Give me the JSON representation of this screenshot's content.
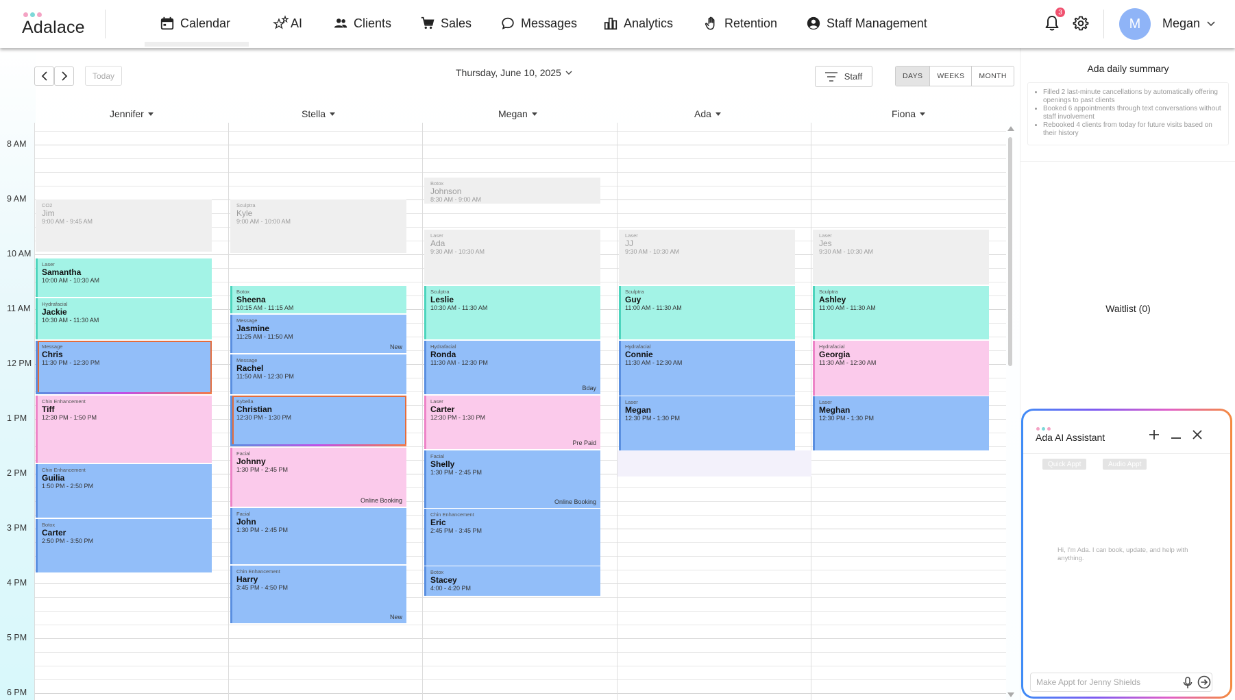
{
  "app": {
    "logo_text": "Adalace",
    "logo_dot_colors": [
      "#f4a3c4",
      "#7dd8d8",
      "#f4a3c4"
    ]
  },
  "nav": {
    "items": [
      {
        "label": "Calendar",
        "icon": "calendar-icon",
        "active": true
      },
      {
        "label": "AI",
        "icon": "stars-icon"
      },
      {
        "label": "Clients",
        "icon": "people-icon"
      },
      {
        "label": "Sales",
        "icon": "cart-icon"
      },
      {
        "label": "Messages",
        "icon": "chat-bubble-icon"
      },
      {
        "label": "Analytics",
        "icon": "bar-chart-icon"
      },
      {
        "label": "Retention",
        "icon": "hand-icon"
      },
      {
        "label": "Staff Management",
        "icon": "account-circle-icon"
      }
    ],
    "notification_count": "3",
    "user_initial": "M",
    "user_name": "Megan"
  },
  "toolbar": {
    "today_label": "Today",
    "date_label": "Thursday, June 10, 2025",
    "staff_filter_label": "Staff",
    "views": [
      "DAYS",
      "WEEKS",
      "MONTH"
    ],
    "active_view": "DAYS"
  },
  "calendar": {
    "hours": [
      "8 AM",
      "9 AM",
      "10 AM",
      "11 AM",
      "12 PM",
      "1 PM",
      "2 PM",
      "3 PM",
      "4 PM",
      "5 PM",
      "6 PM"
    ],
    "staff": [
      {
        "name": "Jennifer",
        "appointments": [
          {
            "service": "CO2",
            "name": "Jim",
            "time": "9:00 AM - 9:45 AM",
            "start": 9.0,
            "end": 9.95,
            "color": "gray"
          },
          {
            "service": "Laser",
            "name": "Samantha",
            "time": "10:00 AM - 10:30 AM",
            "start": 10.08,
            "end": 10.78,
            "color": "teal"
          },
          {
            "service": "Hydrafacial",
            "name": "Jackie",
            "time": "10:30 AM - 11:30 AM",
            "start": 10.8,
            "end": 11.55,
            "color": "teal"
          },
          {
            "service": "Message",
            "name": "Chris",
            "time": "11:30 PM - 12:30 PM",
            "start": 11.57,
            "end": 12.55,
            "color": "blue",
            "ring": true
          },
          {
            "service": "Chin Enhancement",
            "name": "Tiff",
            "time": "12:30 PM - 1:50 PM",
            "start": 12.57,
            "end": 13.8,
            "color": "pink"
          },
          {
            "service": "Chin Enhancement",
            "name": "Guilia",
            "time": "1:50 PM - 2:50 PM",
            "start": 13.82,
            "end": 14.8,
            "color": "blue"
          },
          {
            "service": "Botox",
            "name": "Carter",
            "time": "2:50 PM - 3:50 PM",
            "start": 14.82,
            "end": 15.8,
            "color": "blue"
          }
        ]
      },
      {
        "name": "Stella",
        "appointments": [
          {
            "service": "Sculptra",
            "name": "Kyle",
            "time": "9:00 AM - 10:00 AM",
            "start": 9.0,
            "end": 9.98,
            "color": "gray"
          },
          {
            "service": "Botox",
            "name": "Sheena",
            "time": "10:15 AM - 11:15 AM",
            "start": 10.58,
            "end": 11.07,
            "color": "teal"
          },
          {
            "service": "Message",
            "name": "Jasmine",
            "time": "11:25 AM - 11:50 AM",
            "start": 11.1,
            "end": 11.8,
            "color": "blue",
            "tag": "New"
          },
          {
            "service": "Message",
            "name": "Rachel",
            "time": "11:50 AM - 12:30 PM",
            "start": 11.82,
            "end": 12.55,
            "color": "blue"
          },
          {
            "service": "Kybella",
            "name": "Christian",
            "time": "12:30 PM - 1:30 PM",
            "start": 12.57,
            "end": 13.5,
            "color": "blue",
            "ring": true
          },
          {
            "service": "Facial",
            "name": "Johnny",
            "time": "1:30 PM - 2:45 PM",
            "start": 13.52,
            "end": 14.6,
            "color": "pink",
            "tag": "Online Booking"
          },
          {
            "service": "Facial",
            "name": "John",
            "time": "1:30 PM - 2:45 PM",
            "start": 14.62,
            "end": 15.65,
            "color": "blue"
          },
          {
            "service": "Chin Enhancement",
            "name": "Harry",
            "time": "3:45 PM - 4:50 PM",
            "start": 15.67,
            "end": 16.72,
            "color": "blue",
            "tag": "New"
          }
        ]
      },
      {
        "name": "Megan",
        "appointments": [
          {
            "service": "Botox",
            "name": "Johnson",
            "time": "8:30 AM - 9:00 AM",
            "start": 8.6,
            "end": 9.08,
            "color": "gray"
          },
          {
            "service": "Laser",
            "name": "Ada",
            "time": "9:30 AM - 10:30 AM",
            "start": 9.55,
            "end": 10.55,
            "color": "gray"
          },
          {
            "service": "Sculptra",
            "name": "Leslie",
            "time": "10:30 AM - 11:30 AM",
            "start": 10.57,
            "end": 11.55,
            "color": "teal"
          },
          {
            "service": "Hydrafacial",
            "name": "Ronda",
            "time": "11:30 AM - 12:30 PM",
            "start": 11.57,
            "end": 12.55,
            "color": "blue",
            "tag": "Bday"
          },
          {
            "service": "Laser",
            "name": "Carter",
            "time": "12:30 PM - 1:30 PM",
            "start": 12.57,
            "end": 13.55,
            "color": "pink",
            "tag": "Pre Paid"
          },
          {
            "service": "Facial",
            "name": "Shelly",
            "time": "1:30 PM - 2:45 PM",
            "start": 13.57,
            "end": 14.62,
            "color": "blue",
            "tag": "Online Booking"
          },
          {
            "service": "Chin Enhancement",
            "name": "Eric",
            "time": "2:45 PM - 3:45 PM",
            "start": 14.64,
            "end": 15.67,
            "color": "blue"
          },
          {
            "service": "Botox",
            "name": "Stacey",
            "time": "4:00 - 4:20 PM",
            "start": 15.69,
            "end": 16.22,
            "color": "blue"
          }
        ]
      },
      {
        "name": "Ada",
        "appointments": [
          {
            "service": "Laser",
            "name": "JJ",
            "time": "9:30 AM - 10:30 AM",
            "start": 9.55,
            "end": 10.55,
            "color": "gray"
          },
          {
            "service": "Sculptra",
            "name": "Guy",
            "time": "11:00 AM - 11:30 AM",
            "start": 10.57,
            "end": 11.55,
            "color": "teal"
          },
          {
            "service": "Hydrafacial",
            "name": "Connie",
            "time": "11:30 AM - 12:30 AM",
            "start": 11.57,
            "end": 12.57,
            "color": "blue"
          },
          {
            "service": "Laser",
            "name": "Megan",
            "time": "12:30 PM - 1:30 PM",
            "start": 12.59,
            "end": 13.58,
            "color": "blue"
          }
        ]
      },
      {
        "name": "Fiona",
        "appointments": [
          {
            "service": "Laser",
            "name": "Jes",
            "time": "9:30 AM - 10:30 AM",
            "start": 9.55,
            "end": 10.55,
            "color": "gray"
          },
          {
            "service": "Sculptra",
            "name": "Ashley",
            "time": "11:00 AM - 11:30 AM",
            "start": 10.57,
            "end": 11.55,
            "color": "teal"
          },
          {
            "service": "Hydrafacial",
            "name": "Georgia",
            "time": "11:30 AM - 12:30 AM",
            "start": 11.57,
            "end": 12.57,
            "color": "pink"
          },
          {
            "service": "Laser",
            "name": "Meghan",
            "time": "12:30 PM - 1:30 PM",
            "start": 12.59,
            "end": 13.58,
            "color": "blue"
          }
        ]
      }
    ]
  },
  "summary": {
    "title": "Ada daily summary",
    "items": [
      "Filled 2 last-minute cancellations by automatically offering openings to past clients",
      "Booked 6 appointments through text conversations without staff involvement",
      "Rebooked 4 clients from today for future visits based on their history"
    ]
  },
  "waitlist": {
    "label": "Waitlist (0)"
  },
  "assistant": {
    "title": "Ada AI Assistant",
    "chips": [
      "Quick Appt",
      "Audio Appt"
    ],
    "hint": "Hi, I'm Ada. I can book, update, and help with anything.",
    "input_placeholder": "Make Appt for Jenny Shields"
  }
}
